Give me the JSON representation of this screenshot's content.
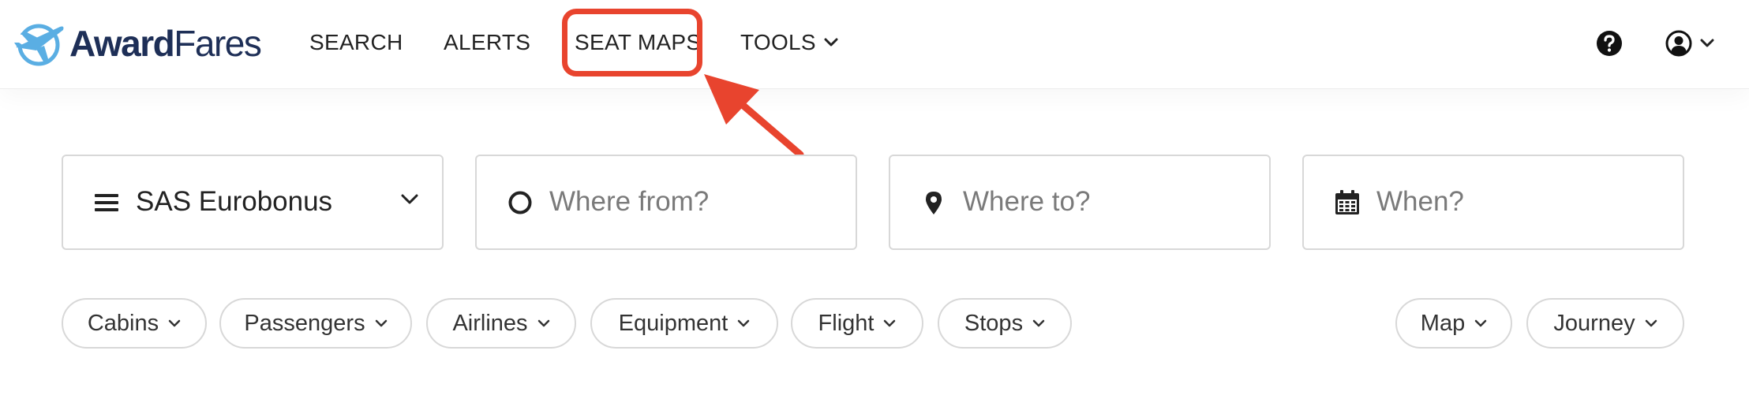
{
  "brand": {
    "name_part1": "Award",
    "name_part2": "Fares",
    "colors": {
      "navy": "#1e2f57",
      "sky": "#5aaee3",
      "highlight": "#e8442e"
    }
  },
  "nav": {
    "items": [
      {
        "label": "SEARCH"
      },
      {
        "label": "ALERTS"
      },
      {
        "label": "SEAT MAPS",
        "highlighted": true
      },
      {
        "label": "TOOLS",
        "icon": "chevron-down-icon"
      }
    ],
    "help_icon": "question-circle-icon",
    "account_icon": "user-circle-icon"
  },
  "search": {
    "program": {
      "value": "SAS Eurobonus",
      "icon": "menu-icon"
    },
    "from": {
      "placeholder": "Where from?",
      "icon": "circle-icon"
    },
    "to": {
      "placeholder": "Where to?",
      "icon": "map-pin-icon"
    },
    "when": {
      "placeholder": "When?",
      "icon": "calendar-icon"
    }
  },
  "filters": {
    "left": [
      "Cabins",
      "Passengers",
      "Airlines",
      "Equipment",
      "Flight",
      "Stops"
    ],
    "right": [
      "Map",
      "Journey"
    ]
  }
}
